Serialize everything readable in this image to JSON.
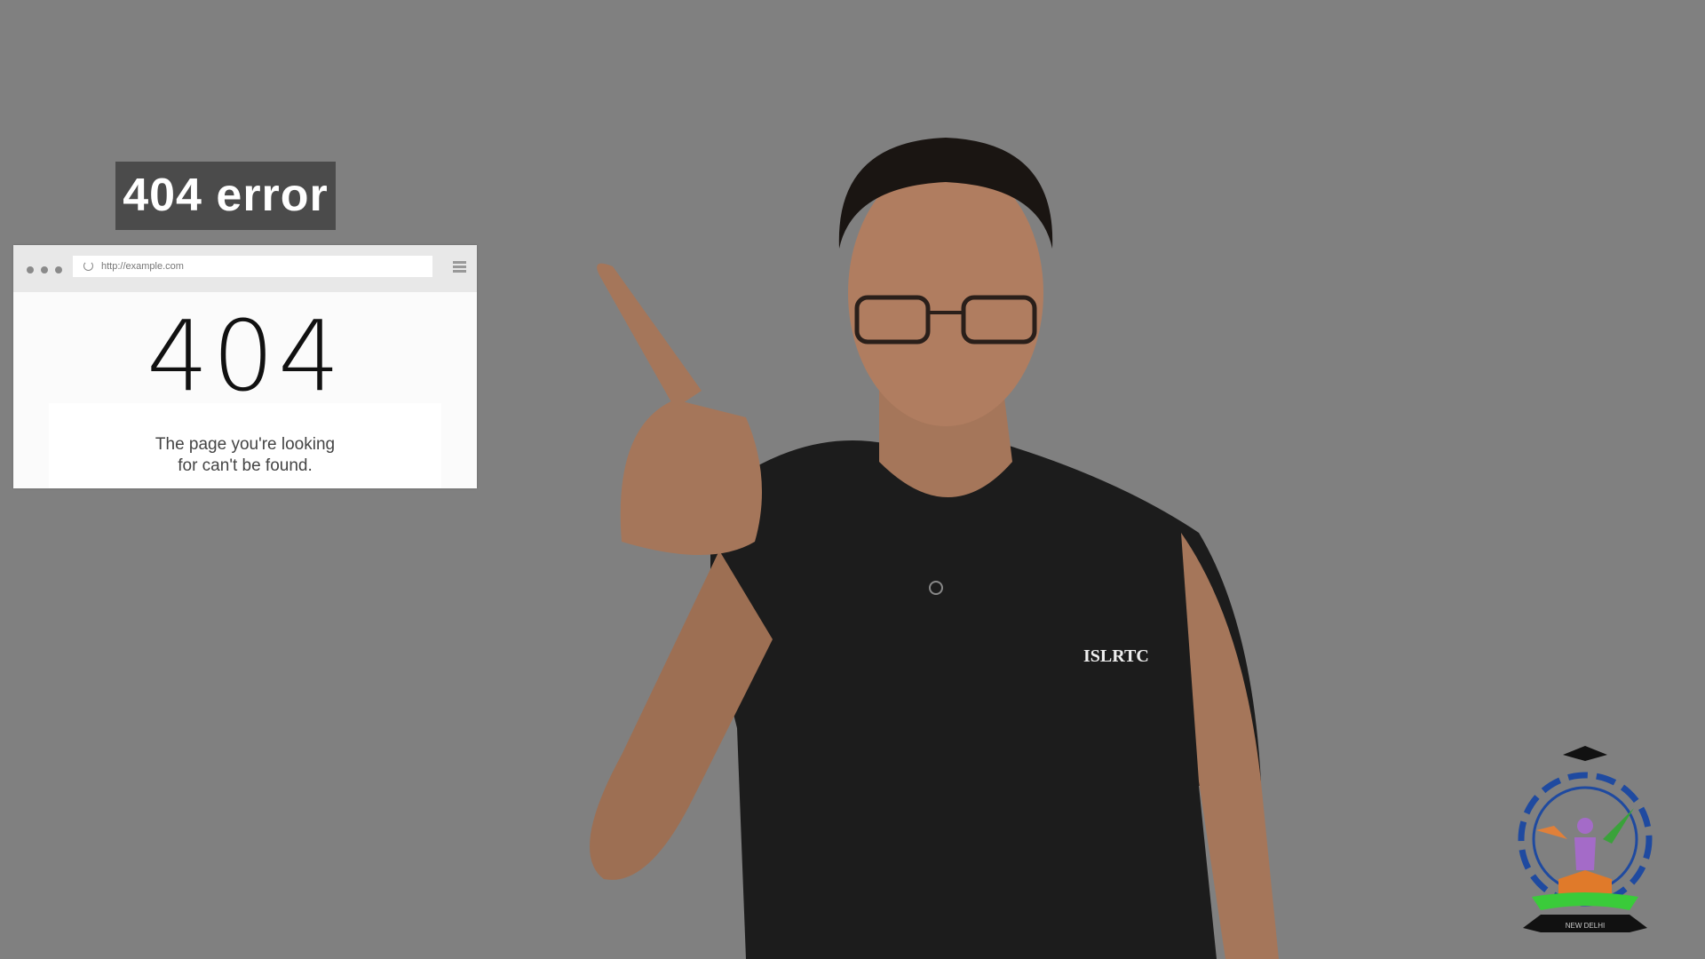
{
  "caption": "404 error",
  "browser": {
    "url": "http://example.com",
    "heading": "404",
    "message_line1": "The page you're looking",
    "message_line2": "for can't be found."
  },
  "person": {
    "shirt_text": "ISLRTC"
  },
  "logo": {
    "text": "NEW DELHI"
  },
  "colors": {
    "background": "#808080",
    "caption_bg": "#4b4b4b"
  }
}
